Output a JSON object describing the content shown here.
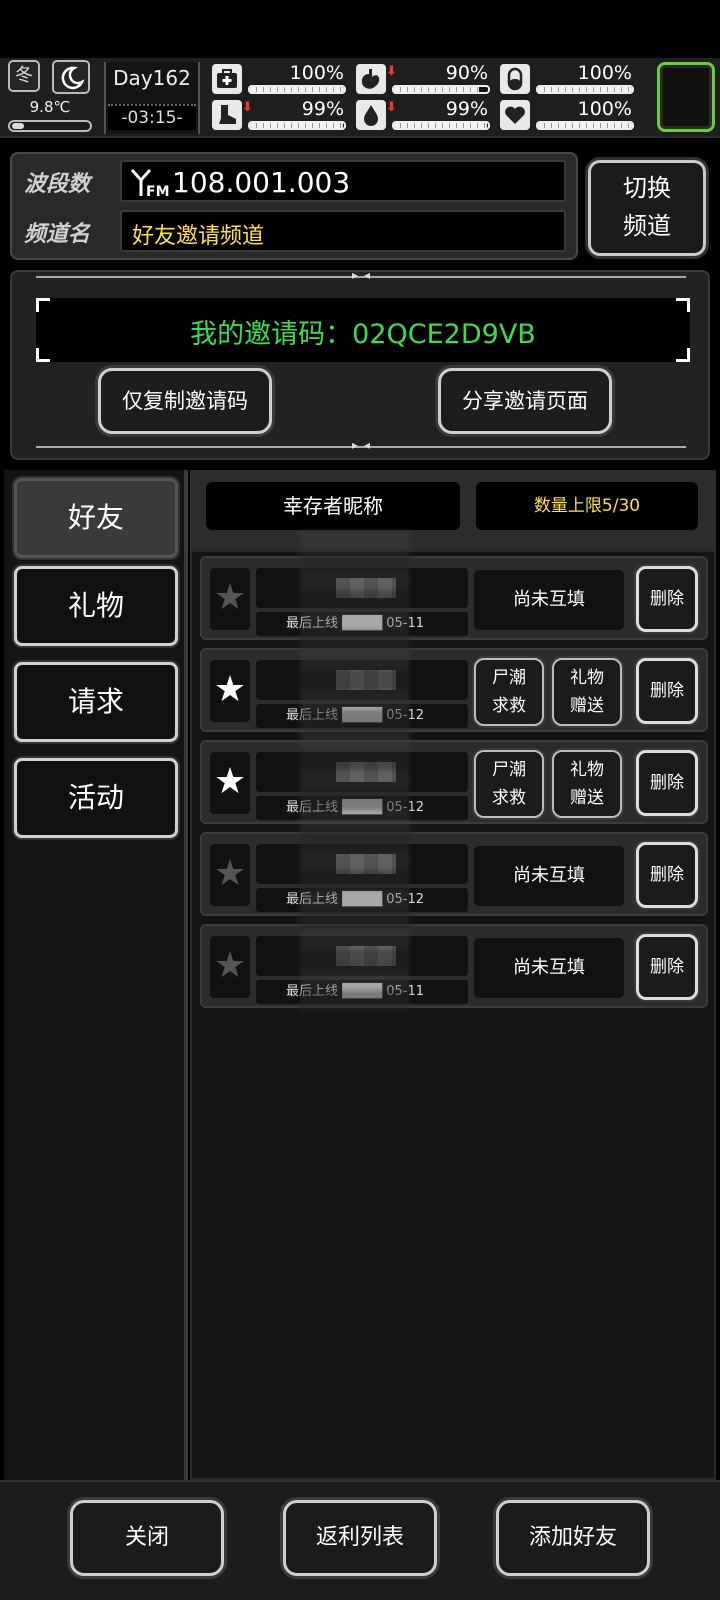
{
  "hud": {
    "season": "冬",
    "temperature": "9.8℃",
    "day": "Day162",
    "clock": "-03:15-",
    "stats": [
      {
        "icon": "medkit-icon",
        "pct": "100%",
        "value": 1.0,
        "down": false
      },
      {
        "icon": "stomach-icon",
        "pct": "90%",
        "value": 0.9,
        "down": true
      },
      {
        "icon": "pill-icon",
        "pct": "100%",
        "value": 1.0,
        "down": false
      },
      {
        "icon": "boot-icon",
        "pct": "99%",
        "value": 0.99,
        "down": true
      },
      {
        "icon": "water-drop-icon",
        "pct": "99%",
        "value": 0.99,
        "down": true
      },
      {
        "icon": "heart-icon",
        "pct": "100%",
        "value": 1.0,
        "down": false
      }
    ]
  },
  "channel": {
    "band_label": "波段数",
    "name_label": "频道名",
    "frequency": "108.001.003",
    "channel_name": "好友邀请频道",
    "switch_label_1": "切换",
    "switch_label_2": "频道"
  },
  "invite": {
    "code_text": "我的邀请码：02QCE2D9VB",
    "copy_label": "仅复制邀请码",
    "share_label": "分享邀请页面"
  },
  "tabs": [
    "好友",
    "礼物",
    "请求",
    "活动"
  ],
  "list": {
    "name_header": "幸存者昵称",
    "limit_text": "数量上限5/30",
    "rows": [
      {
        "starred": false,
        "last": "最后上线 ████ 05-11",
        "status": "尚未互填",
        "delete": "删除"
      },
      {
        "starred": true,
        "last": "最后上线 ████ 05-12",
        "btn1a": "尸潮",
        "btn1b": "求救",
        "btn2a": "礼物",
        "btn2b": "赠送",
        "delete": "删除"
      },
      {
        "starred": true,
        "last": "最后上线 ████ 05-12",
        "btn1a": "尸潮",
        "btn1b": "求救",
        "btn2a": "礼物",
        "btn2b": "赠送",
        "delete": "删除"
      },
      {
        "starred": false,
        "last": "最后上线 ████ 05-12",
        "status": "尚未互填",
        "delete": "删除"
      },
      {
        "starred": false,
        "last": "最后上线 ████ 05-11",
        "status": "尚未互填",
        "delete": "删除"
      }
    ]
  },
  "bottom": {
    "close": "关闭",
    "rebate": "返利列表",
    "add_friend": "添加好友"
  },
  "colors": {
    "accent_green": "#36e04a",
    "accent_yellow": "#ffe23a",
    "frame_green": "#6ecb3c",
    "arrow_red": "#ff3030"
  }
}
